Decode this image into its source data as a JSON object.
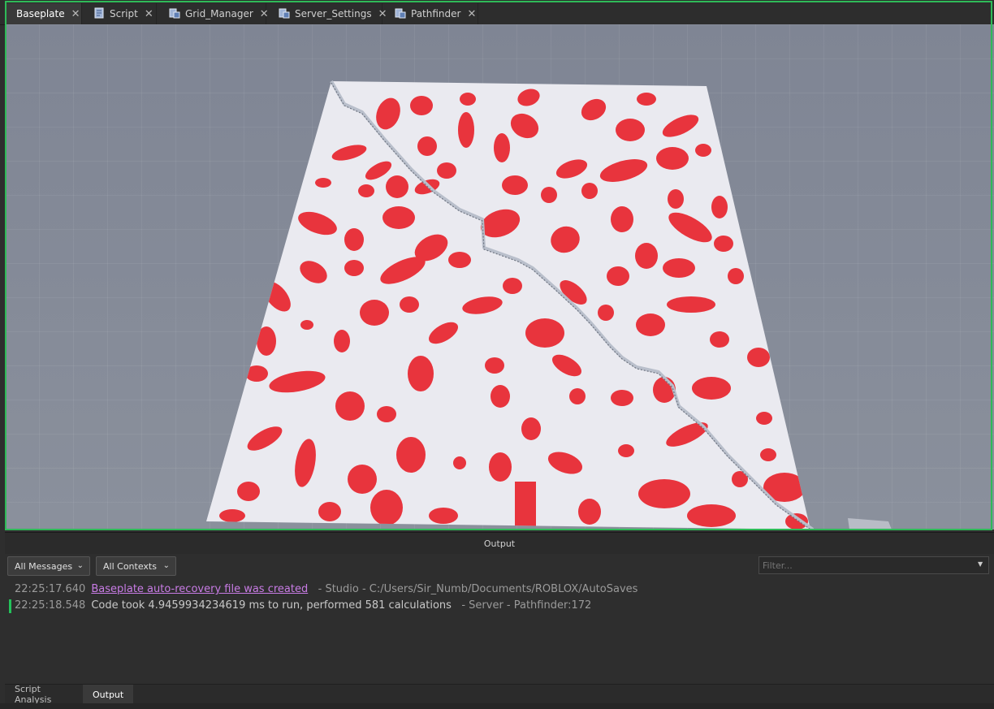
{
  "tabs": [
    {
      "label": "Baseplate",
      "icon": "none",
      "active": true
    },
    {
      "label": "Script",
      "icon": "script-icon",
      "active": false
    },
    {
      "label": "Grid_Manager",
      "icon": "module-script-icon",
      "active": false
    },
    {
      "label": "Server_Settings",
      "icon": "module-script-icon",
      "active": false
    },
    {
      "label": "Pathfinder",
      "icon": "module-script-icon",
      "active": false
    }
  ],
  "output": {
    "title": "Output",
    "message_filter": "All Messages",
    "context_filter": "All Contexts",
    "filter_placeholder": "Filter...",
    "lines": [
      {
        "timestamp": "22:25:17.640",
        "link_text": "Baseplate auto-recovery file was created",
        "source": "-  Studio - C:/Users/Sir_Numb/Documents/ROBLOX/AutoSaves"
      },
      {
        "timestamp": "22:25:18.548",
        "message": "Code took 4.9459934234619 ms to run, performed 581 calculations",
        "source": "-  Server - Pathfinder:172"
      }
    ]
  },
  "bottom_tabs": [
    {
      "label": "Script Analysis",
      "active": false
    },
    {
      "label": "Output",
      "active": true
    }
  ],
  "colors": {
    "accent": "#2fba58",
    "obstacle": "#e8343d",
    "floor": "#eaeaf0",
    "path": "#b9bfcb",
    "link": "#c97ce6"
  }
}
